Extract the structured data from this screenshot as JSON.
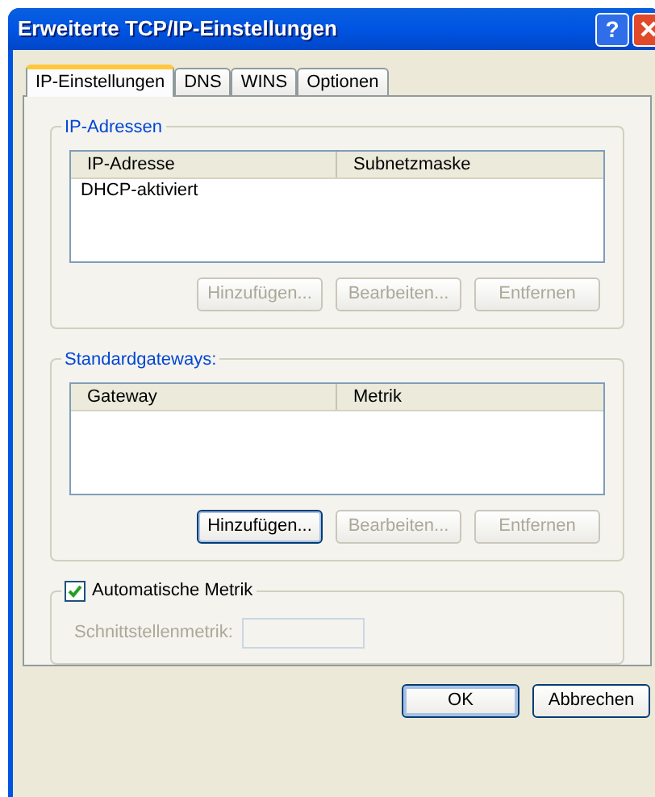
{
  "window": {
    "title": "Erweiterte TCP/IP-Einstellungen",
    "help_button": "?"
  },
  "tabs": [
    {
      "label": "IP-Einstellungen",
      "selected": true
    },
    {
      "label": "DNS",
      "selected": false
    },
    {
      "label": "WINS",
      "selected": false
    },
    {
      "label": "Optionen",
      "selected": false
    }
  ],
  "ip_addresses": {
    "title": "IP-Adressen",
    "columns": [
      "IP-Adresse",
      "Subnetzmaske"
    ],
    "rows": [
      [
        "DHCP-aktiviert"
      ]
    ],
    "buttons": [
      {
        "label": "Hinzufügen...",
        "disabled": true,
        "focused": false
      },
      {
        "label": "Bearbeiten...",
        "disabled": true,
        "focused": false
      },
      {
        "label": "Entfernen",
        "disabled": true,
        "focused": false
      }
    ]
  },
  "gateways": {
    "title": "Standardgateways:",
    "columns": [
      "Gateway",
      "Metrik"
    ],
    "buttons": [
      {
        "label": "Hinzufügen...",
        "disabled": false,
        "focused": true
      },
      {
        "label": "Bearbeiten...",
        "disabled": true,
        "focused": false
      },
      {
        "label": "Entfernen",
        "disabled": true,
        "focused": false
      }
    ]
  },
  "automatic_metric": {
    "label": "Automatische Metrik",
    "checked": true,
    "field_label": "Schnittstellenmetrik:",
    "field_disabled": true
  },
  "buttons": [
    {
      "label": "OK",
      "default": true
    },
    {
      "label": "Abbrechen",
      "default": false
    }
  ]
}
